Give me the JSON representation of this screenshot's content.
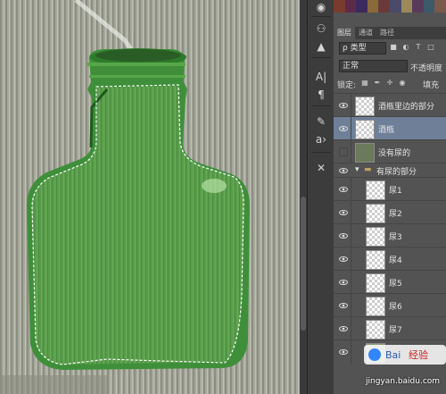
{
  "panel": {
    "tabs": [
      "图层",
      "通道",
      "路径"
    ],
    "filter_kind": "ρ 类型",
    "blend_mode": "正常",
    "opacity_label": "不透明度",
    "lock_label": "锁定:",
    "fill_label": "填充",
    "layers": [
      {
        "name": "酒瓶里边的部分",
        "visible": true,
        "selected": false,
        "kind": "thumb"
      },
      {
        "name": "酒瓶",
        "visible": true,
        "selected": true,
        "kind": "thumb"
      },
      {
        "name": "没有尿的",
        "visible": false,
        "selected": false,
        "kind": "photo"
      },
      {
        "name": "有尿的部分",
        "visible": true,
        "selected": false,
        "kind": "group"
      },
      {
        "name": "尿1",
        "visible": true,
        "selected": false,
        "kind": "thumb"
      },
      {
        "name": "尿2",
        "visible": true,
        "selected": false,
        "kind": "thumb"
      },
      {
        "name": "尿3",
        "visible": true,
        "selected": false,
        "kind": "thumb"
      },
      {
        "name": "尿4",
        "visible": true,
        "selected": false,
        "kind": "thumb"
      },
      {
        "name": "尿5",
        "visible": true,
        "selected": false,
        "kind": "thumb"
      },
      {
        "name": "尿6",
        "visible": true,
        "selected": false,
        "kind": "thumb"
      },
      {
        "name": "尿7",
        "visible": true,
        "selected": false,
        "kind": "thumb"
      }
    ]
  },
  "watermark": {
    "brand": "Bai 经验",
    "url": "jingyan.baidu.com"
  },
  "colors": {
    "selected_layer": "#6f7f98",
    "panel_bg": "#535353",
    "bottle_green": "#3f8f3a"
  }
}
